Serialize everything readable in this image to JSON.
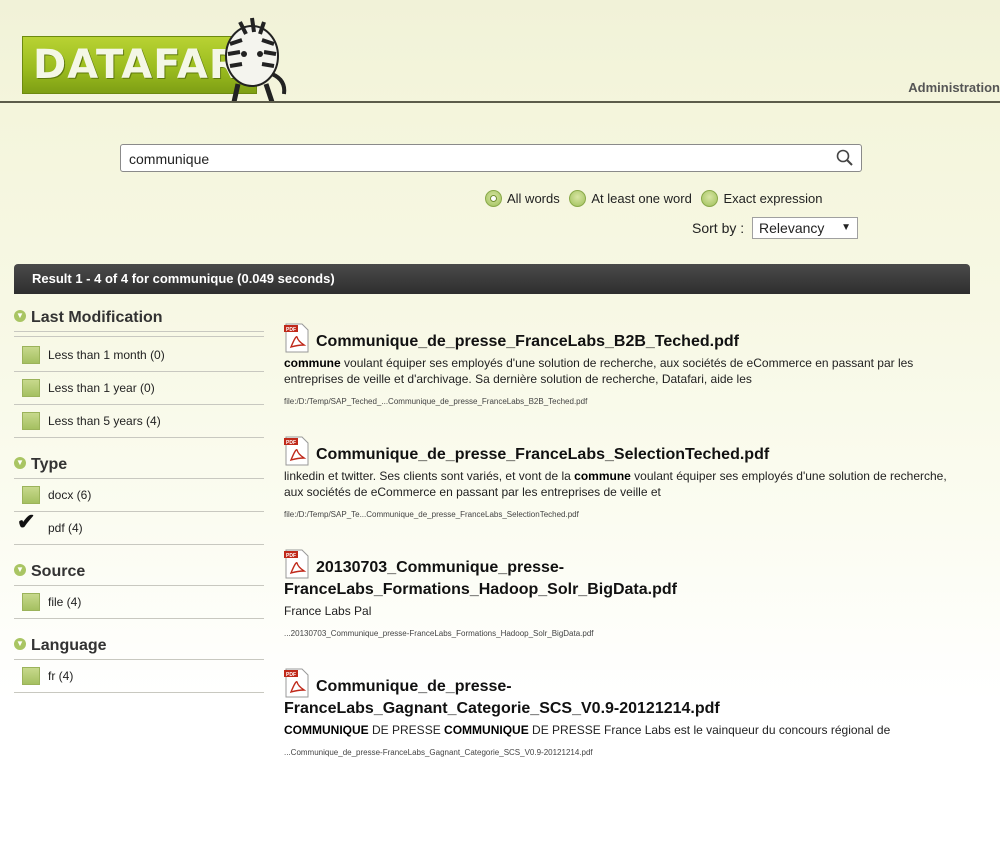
{
  "header": {
    "logo_text": "DATAFARI",
    "admin_link": "Administration"
  },
  "search": {
    "value": "communique",
    "placeholder": ""
  },
  "match_modes": [
    {
      "label": "All words",
      "selected": true
    },
    {
      "label": "At least one word",
      "selected": false
    },
    {
      "label": "Exact expression",
      "selected": false
    }
  ],
  "sort": {
    "label": "Sort by :",
    "selected": "Relevancy"
  },
  "result_bar": "Result 1 - 4 of 4 for communique (0.049 seconds)",
  "facets": [
    {
      "title": "Last Modification",
      "items": [
        {
          "label": "Less than 1 month (0)",
          "checked": false
        },
        {
          "label": "Less than 1 year (0)",
          "checked": false
        },
        {
          "label": "Less than 5 years (4)",
          "checked": false
        }
      ]
    },
    {
      "title": "Type",
      "items": [
        {
          "label": "docx (6)",
          "checked": false
        },
        {
          "label": "pdf (4)",
          "checked": true
        }
      ]
    },
    {
      "title": "Source",
      "items": [
        {
          "label": "file (4)",
          "checked": false
        }
      ]
    },
    {
      "title": "Language",
      "items": [
        {
          "label": "fr (4)",
          "checked": false
        }
      ]
    }
  ],
  "results": [
    {
      "title": "Communique_de_presse_FranceLabs_B2B_Teched.pdf",
      "snippet_hl": "commune",
      "snippet_rest": " voulant équiper ses employés d'une solution de recherche, aux sociétés de eCommerce en passant par les entreprises de veille et d'archivage. Sa dernière solution de recherche, Datafari, aide les",
      "url": "file:/D:/Temp/SAP_Teched_...Communique_de_presse_FranceLabs_B2B_Teched.pdf"
    },
    {
      "title": "Communique_de_presse_FranceLabs_SelectionTeched.pdf",
      "snippet_pre": "linkedin et twitter. Ses clients sont variés, et vont de la ",
      "snippet_hl": "commune",
      "snippet_rest": " voulant équiper ses employés d'une solution de recherche, aux sociétés de eCommerce en passant par les entreprises de veille et",
      "url": "file:/D:/Temp/SAP_Te...Communique_de_presse_FranceLabs_SelectionTeched.pdf"
    },
    {
      "title_line1": "20130703_Communique_presse-",
      "title_line2": "FranceLabs_Formations_Hadoop_Solr_BigData.pdf",
      "snippet": "France Labs Pal",
      "url": "...20130703_Communique_presse-FranceLabs_Formations_Hadoop_Solr_BigData.pdf"
    },
    {
      "title_line1": "Communique_de_presse-",
      "title_line2": "FranceLabs_Gagnant_Categorie_SCS_V0.9-20121214.pdf",
      "snippet_hl1": "COMMUNIQUE",
      "snippet_mid1": " DE PRESSE ",
      "snippet_hl2": "COMMUNIQUE",
      "snippet_rest": " DE PRESSE France Labs est le vainqueur du concours régional de",
      "url": "...Communique_de_presse-FranceLabs_Gagnant_Categorie_SCS_V0.9-20121214.pdf"
    }
  ]
}
